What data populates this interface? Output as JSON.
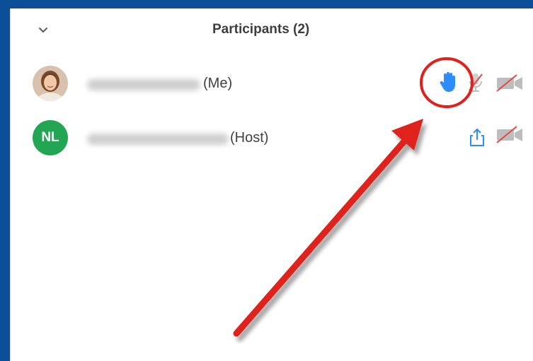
{
  "header": {
    "title": "Participants (2)"
  },
  "participants": [
    {
      "suffix": "(Me)",
      "avatar": "photo",
      "icons": [
        "raise-hand-icon",
        "mic-muted-icon",
        "video-off-icon"
      ]
    },
    {
      "suffix": "(Host)",
      "initials": "NL",
      "avatar_color": "#22a653",
      "icons": [
        "share-screen-icon",
        "video-off-icon"
      ]
    }
  ],
  "colors": {
    "frame": "#0b4f99",
    "raise_hand": "#2d8cff",
    "annotation": "#e0201c"
  }
}
